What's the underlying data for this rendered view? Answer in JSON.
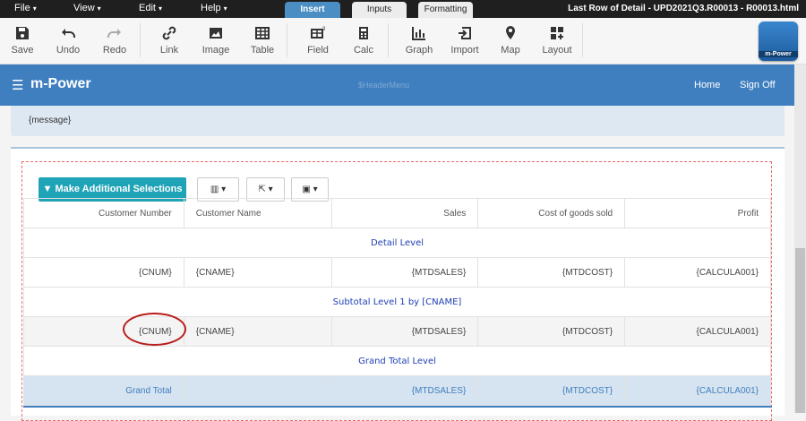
{
  "menubar": {
    "menus": [
      "File",
      "View",
      "Edit",
      "Help"
    ],
    "mode_tabs": [
      "Insert",
      "Inputs",
      "Formatting"
    ],
    "file_title": "Last Row of Detail - UPD2021Q3.R00013 - R00013.html"
  },
  "toolbar": {
    "tools": [
      "Save",
      "Undo",
      "Redo",
      "Link",
      "Image",
      "Table",
      "Field",
      "Calc",
      "Graph",
      "Import",
      "Map",
      "Layout"
    ],
    "logo_text": "m-Power"
  },
  "appbar": {
    "brand": "m-Power",
    "header_menu": "$HeaderMenu",
    "nav": [
      "Home",
      "Sign Off"
    ]
  },
  "message": "{message}",
  "actions": {
    "primary": "Make Additional Selections"
  },
  "table": {
    "headers": [
      "Customer Number",
      "Customer Name",
      "Sales",
      "Cost of goods sold",
      "Profit"
    ],
    "detail_level": "Detail Level",
    "detail_row": [
      "{CNUM}",
      "{CNAME}",
      "{MTDSALES}",
      "{MTDCOST}",
      "{CALCULA001}"
    ],
    "subtotal_level": "Subtotal Level 1 by [CNAME]",
    "subtotal_row": [
      "{CNUM}",
      "{CNAME}",
      "{MTDSALES}",
      "{MTDCOST}",
      "{CALCULA001}"
    ],
    "grand_level": "Grand Total Level",
    "grand_row": [
      "Grand Total",
      "",
      "{MTDSALES}",
      "{MTDCOST}",
      "{CALCULA001}"
    ]
  }
}
